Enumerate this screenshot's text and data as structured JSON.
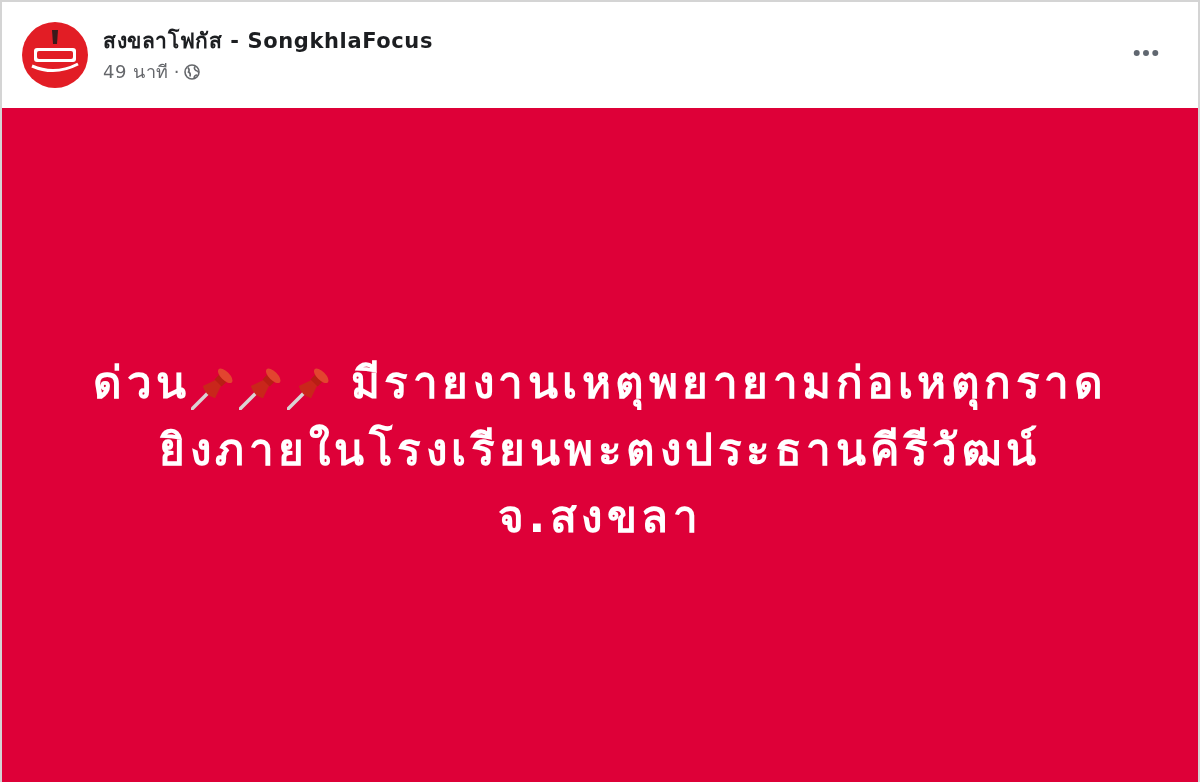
{
  "post": {
    "author": {
      "name": "สงขลาโฟกัส - SongkhlaFocus"
    },
    "time": "49 นาที",
    "separator": "·",
    "body": {
      "lines": [
        {
          "segments": [
            {
              "kind": "text",
              "text": "ด่วน"
            },
            {
              "kind": "pin"
            },
            {
              "kind": "pin"
            },
            {
              "kind": "pin"
            },
            {
              "kind": "text",
              "text": "มีรายงานเหตุพยายามก่อเหตุกราด"
            }
          ]
        },
        {
          "segments": [
            {
              "kind": "text",
              "text": "ยิงภายในโรงเรียนพะตงประธานคีรีวัฒน์"
            }
          ]
        },
        {
          "segments": [
            {
              "kind": "text",
              "text": "จ.สงขลา"
            }
          ]
        }
      ]
    }
  }
}
